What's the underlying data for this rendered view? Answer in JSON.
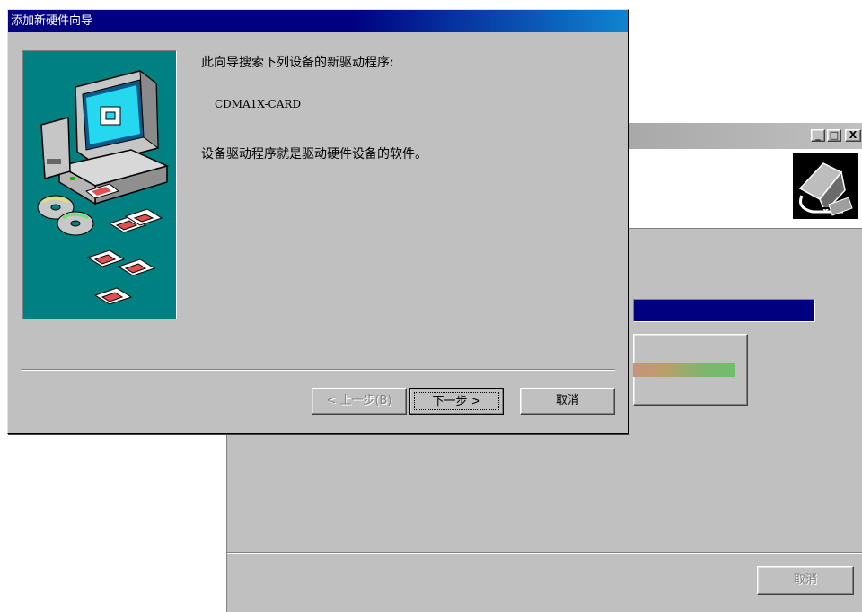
{
  "background_window": {
    "minimize_glyph": "_",
    "maximize_glyph": "□",
    "close_glyph": "X",
    "header_icon": "hardware-wizard-icon",
    "cancel_label": "取消"
  },
  "wizard": {
    "title": "添加新硬件向导",
    "intro_text": "此向导搜索下列设备的新驱动程序:",
    "device_name": "CDMA1X-CARD",
    "description_text": "设备驱动程序就是驱动硬件设备的软件。",
    "illustration": "computer-with-discs-illustration",
    "buttons": {
      "back_label": "< 上一步(B)",
      "next_label": "下一步 >",
      "cancel_label": "取消"
    }
  },
  "colors": {
    "title_bar_active": "#000080",
    "illustration_background": "#008080",
    "dialog_face": "#c0c0c0"
  }
}
